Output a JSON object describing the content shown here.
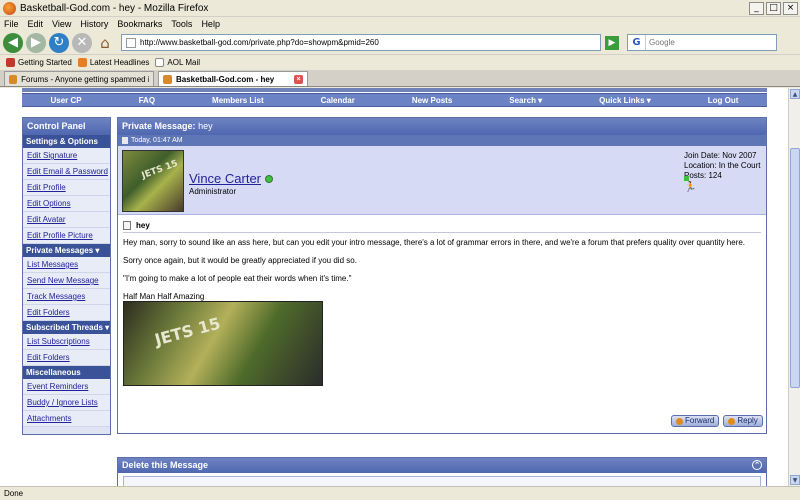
{
  "window": {
    "title": "Basketball-God.com - hey - Mozilla Firefox",
    "min": "_",
    "max": "□",
    "close": "×"
  },
  "menu": [
    "File",
    "Edit",
    "View",
    "History",
    "Bookmarks",
    "Tools",
    "Help"
  ],
  "nav": {
    "url": "http://www.basketball-god.com/private.php?do=showpm&pmid=260",
    "search_placeholder": "Google",
    "search_engine": "G"
  },
  "bookmarks": [
    {
      "label": "Getting Started",
      "color": "#c0392b"
    },
    {
      "label": "Latest Headlines",
      "color": "#e67e22"
    },
    {
      "label": "AOL Mail",
      "color": "#ffffff"
    }
  ],
  "tabs": [
    {
      "label": "Forums - Anyone getting spammed in ...",
      "active": false
    },
    {
      "label": "Basketball-God.com - hey",
      "active": true
    }
  ],
  "forum_nav": [
    "User CP",
    "FAQ",
    "Members List",
    "Calendar",
    "New Posts",
    "Search ▾",
    "Quick Links ▾",
    "Log Out"
  ],
  "control_panel": {
    "title": "Control Panel",
    "sections": [
      {
        "heading": "Settings & Options",
        "items": [
          "Edit Signature",
          "Edit Email & Password",
          "Edit Profile",
          "Edit Options",
          "Edit Avatar",
          "Edit Profile Picture"
        ]
      },
      {
        "heading": "Private Messages ▾",
        "items": [
          "List Messages",
          "Send New Message",
          "Track Messages",
          "Edit Folders"
        ]
      },
      {
        "heading": "Subscribed Threads ▾",
        "items": [
          "List Subscriptions",
          "Edit Folders"
        ]
      },
      {
        "heading": "Miscellaneous",
        "items": [
          "Event Reminders",
          "Buddy / Ignore Lists",
          "Attachments"
        ]
      }
    ]
  },
  "message": {
    "header_label": "Private Message:",
    "header_subject": "hey",
    "date": "Today, 01:47 AM",
    "username": "Vince Carter",
    "user_title": "Administrator",
    "join_date": "Join Date: Nov 2007",
    "location": "Location: In the Court",
    "posts": "Posts: 124",
    "subject": "hey",
    "paragraphs": [
      "Hey man, sorry to sound like an ass here, but can you edit your intro message, there's a lot of grammar errors in there, and we're a forum that prefers quality over quantity here.",
      "Sorry once again, but it would be greatly appreciated if you did so.",
      "\"I'm going to make a lot of people eat their words when it's time.\"",
      "Half Man Half Amazing"
    ],
    "forward_label": "Forward",
    "reply_label": "Reply"
  },
  "delete_panel": {
    "title": "Delete this Message"
  },
  "status": "Done",
  "avatar_text": "JETS 15"
}
